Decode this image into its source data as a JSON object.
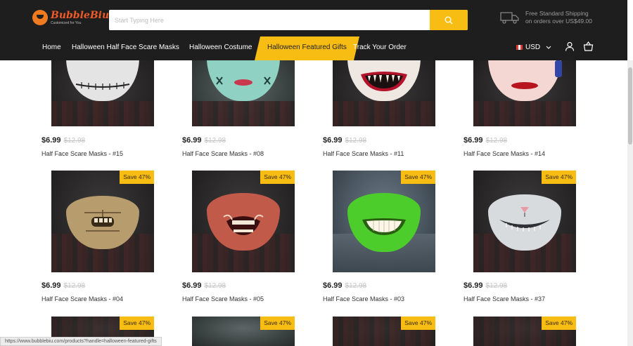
{
  "header": {
    "logo_name": "BubbleBiu",
    "logo_tagline": "Customized for You",
    "search_placeholder": "Start Typing Here",
    "shipping_line1": "Free Standard Shipping",
    "shipping_line2": "on orders over US$49.00"
  },
  "nav": {
    "items": [
      {
        "label": "Home"
      },
      {
        "label": "Halloween Half Face Scare Masks"
      },
      {
        "label": "Halloween Costume"
      },
      {
        "label": "Halloween Featured Gifts"
      },
      {
        "label": "Track Your Order"
      }
    ],
    "currency": "USD"
  },
  "badge_text": "Save 47%",
  "products": [
    {
      "price": "$6.99",
      "old_price": "$12.98",
      "title": "Half Face Scare Masks - #15",
      "badge": false,
      "mask": "skull"
    },
    {
      "price": "$6.99",
      "old_price": "$12.98",
      "title": "Half Face Scare Masks - #08",
      "badge": false,
      "mask": "stitch"
    },
    {
      "price": "$6.99",
      "old_price": "$12.98",
      "title": "Half Face Scare Masks - #11",
      "badge": false,
      "mask": "clown"
    },
    {
      "price": "$6.99",
      "old_price": "$12.98",
      "title": "Half Face Scare Masks - #14",
      "badge": false,
      "mask": "joker"
    },
    {
      "price": "$6.99",
      "old_price": "$12.98",
      "title": "Half Face Scare Masks - #04",
      "badge": true,
      "mask": "hannibal"
    },
    {
      "price": "$6.99",
      "old_price": "$12.98",
      "title": "Half Face Scare Masks - #05",
      "badge": true,
      "mask": "freddy"
    },
    {
      "price": "$6.99",
      "old_price": "$12.98",
      "title": "Half Face Scare Masks - #03",
      "badge": true,
      "mask": "green"
    },
    {
      "price": "$6.99",
      "old_price": "$12.98",
      "title": "Half Face Scare Masks - #37",
      "badge": true,
      "mask": "cat"
    }
  ],
  "status_url": "https://www.bubblebiu.com/products?handle=halloween-featured-gifts",
  "colors": {
    "accent": "#f7bd12",
    "header_bg": "#1e1e1e",
    "brand": "#f05a28"
  }
}
